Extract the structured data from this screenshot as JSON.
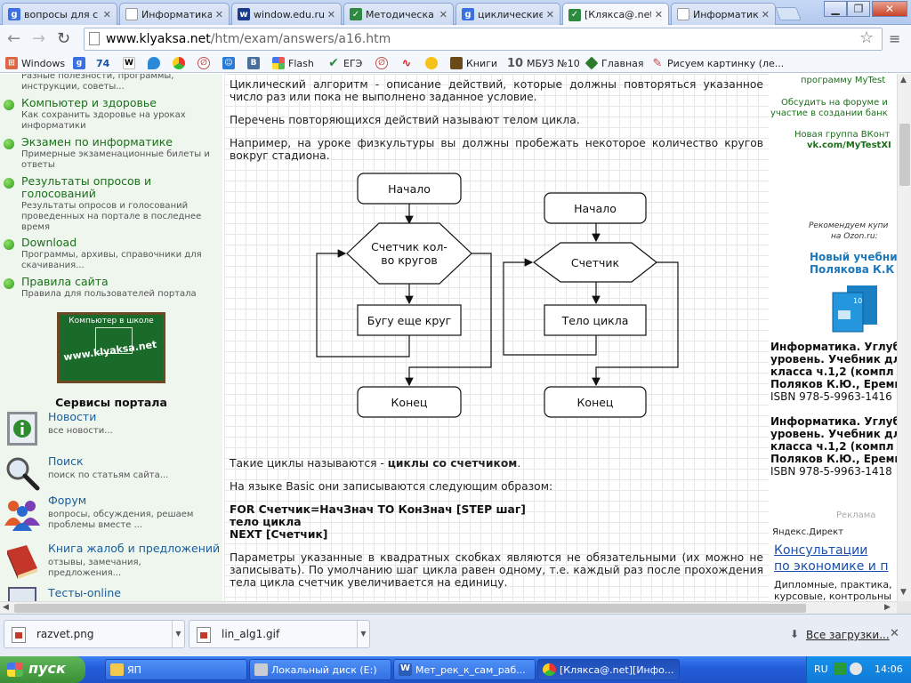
{
  "browser": {
    "tabs": [
      {
        "title": "вопросы для с",
        "icon": "google",
        "color": "#3a70e0"
      },
      {
        "title": "Информатика",
        "icon": "page",
        "color": "#ffffff"
      },
      {
        "title": "window.edu.ru",
        "icon": "window-edu",
        "color": "#1b3a8c"
      },
      {
        "title": "Методическа",
        "icon": "check",
        "color": "#2d8a3e"
      },
      {
        "title": "циклические",
        "icon": "google",
        "color": "#3a70e0"
      },
      {
        "title": "[Кляксa@.net]",
        "icon": "klyaksa",
        "color": "#2d8a3e"
      },
      {
        "title": "Информатика",
        "icon": "page",
        "color": "#ffffff"
      }
    ],
    "url_host": "www.klyaksa.net",
    "url_path": "/htm/exam/answers/a16.htm",
    "bookmarks": [
      {
        "label": "Windows",
        "icon": "windows"
      },
      {
        "label": "",
        "icon": "google"
      },
      {
        "label": "74",
        "icon": ""
      },
      {
        "label": "",
        "icon": "wikipedia"
      },
      {
        "label": "",
        "icon": "drop"
      },
      {
        "label": "",
        "icon": "chrome-store"
      },
      {
        "label": "",
        "icon": "klyaksa"
      },
      {
        "label": "",
        "icon": "smiley"
      },
      {
        "label": "",
        "icon": "vk"
      },
      {
        "label": "Flash",
        "icon": "windows"
      },
      {
        "label": "ЕГЭ",
        "icon": "check"
      },
      {
        "label": "",
        "icon": "klyaksa"
      },
      {
        "label": "",
        "icon": "pulse"
      },
      {
        "label": "",
        "icon": "sun"
      },
      {
        "label": "Книги",
        "icon": "book"
      },
      {
        "label": "МБУЗ №10",
        "icon": "ten"
      },
      {
        "label": "Главная",
        "icon": "diamond"
      },
      {
        "label": "Рисуем картинку (ле...",
        "icon": "brush"
      }
    ]
  },
  "sidebar": {
    "cut_text": "Разные полезности, программы, инструкции, советы...",
    "items": [
      {
        "label": "Компьютер и здоровье",
        "desc": "Как сохранить здоровье на уроках информатики"
      },
      {
        "label": "Экзамен по информатике",
        "desc": "Примерные экзаменационные билеты и ответы"
      },
      {
        "label": "Результаты опросов и голосований",
        "desc": "Результаты опросов и голосований проведенных на портале в последнее время"
      },
      {
        "label": "Download",
        "desc": "Программы, архивы, справочники для скачивания..."
      },
      {
        "label": "Правила сайта",
        "desc": "Правила для пользователей портала"
      }
    ],
    "banner_top": "Компьютер в школе",
    "banner_main": "www.klyaksa.net",
    "services_title": "Сервисы портала",
    "services": [
      {
        "label": "Новости",
        "desc": "все новости...",
        "icon": "info-icon"
      },
      {
        "label": "Поиск",
        "desc": "поиск по статьям сайта...",
        "icon": "magnifier-icon"
      },
      {
        "label": "Форум",
        "desc": "вопросы, обсуждения, решаем проблемы вместе ...",
        "icon": "people-icon"
      },
      {
        "label": "Книга жалоб и предложений",
        "desc": "отзывы, замечания, предложения...",
        "icon": "book-icon"
      },
      {
        "label": "Тесты-online",
        "desc": "",
        "icon": "monitor-icon"
      }
    ]
  },
  "content": {
    "p1": "Циклический алгоритм - описание действий, которые должны повторяться указанное число раз или пока не выполнено заданное условие.",
    "p2": "Перечень повторяющихся действий называют телом цикла.",
    "p3": "Например, на уроке физкультуры вы должны пробежать некоторое количество кругов вокруг стадиона.",
    "flow_left": {
      "start": "Начало",
      "cond_line1": "Счетчик кол-",
      "cond_line2": "во кругов",
      "body": "Бугу еще круг",
      "end": "Конец"
    },
    "flow_right": {
      "start": "Начало",
      "cond": "Счетчик",
      "body": "Тело цикла",
      "end": "Конец"
    },
    "p4_prefix": "Такие циклы называются - ",
    "p4_bold": "циклы со счетчиком",
    "p4_suffix": ".",
    "p5": "На языке Basic они записываются следующим образом:",
    "code1": "FOR Счетчик=НачЗнач TO КонЗнач [STEP шаг]",
    "code2": "тело цикла",
    "code3": "NEXT [Счетчик]",
    "p6": "Параметры указанные в квадратных скобках являются не обязательными (их можно не записывать). По умолчанию шаг цикла равен одному, т.е. каждый раз после прохождения тела цикла счетчик увеличивается на единицу."
  },
  "right": {
    "mytest": "программу MyTest",
    "forum_line1": "Обсудить на форуме и",
    "forum_line2": "участие в создании банк",
    "vk_line1": "Новая группа ВКонт",
    "vk_line2": "vk.com/MyTestXI",
    "recommend_line1": "Рекомендуем купи",
    "recommend_line2": "на Ozon.ru:",
    "new_book_line1": "Новый учебни",
    "new_book_line2": "Полякова К.К",
    "book1": [
      "Информатика. Углуб",
      "уровень. Учебник дл",
      "класса ч.1,2 (компл",
      "Поляков К.Ю., Ереми"
    ],
    "isbn1": "ISBN 978-5-9963-1416",
    "book2": [
      "Информатика. Углуб",
      "уровень. Учебник дл",
      "класса ч.1,2 (компл",
      "Поляков К.Ю., Ереми"
    ],
    "isbn2": "ISBN 978-5-9963-1418",
    "ad_label": "Реклама",
    "yandex": "Яндекс.Директ",
    "ad_title_line1": "Консультации",
    "ad_title_line2": "по экономике и п",
    "ad_text_line1": "Дипломные, практика,",
    "ad_text_line2": "курсовые, контрольны"
  },
  "downloads": {
    "items": [
      "razvet.png",
      "lin_alg1.gif"
    ],
    "all_label": "Все загрузки..."
  },
  "taskbar": {
    "start_label": "пуск",
    "tasks": [
      "ЯП",
      "Локальный диск (E:)",
      "Мет_рек_к_сам_раб...",
      "[Кляксa@.net][Инфо..."
    ],
    "lang": "RU",
    "clock": "14:06"
  }
}
